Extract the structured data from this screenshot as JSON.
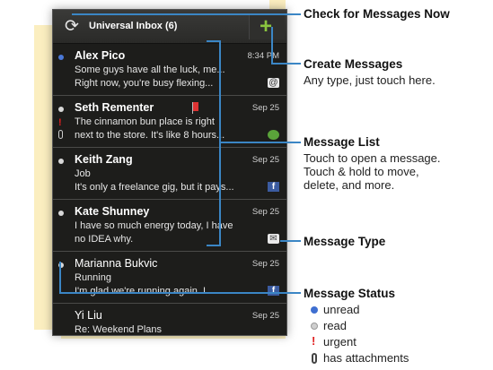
{
  "header": {
    "title": "Universal Inbox (6)",
    "refresh_icon": "refresh-icon",
    "add_icon": "plus-icon",
    "add_glyph": "+"
  },
  "messages": [
    {
      "sender": "Alex Pico",
      "date": "8:34 PM",
      "line1": "Some guys have all the luck, me...",
      "line2": "Right now, you're busy flexing...",
      "status": "unread",
      "type": "email"
    },
    {
      "sender": "Seth Rementer",
      "date": "Sep 25",
      "line1": "The cinnamon bun place is right",
      "line2": "next to the store. It's like 8 hours...",
      "status": "read",
      "type": "sms"
    },
    {
      "sender": "Keith Zang",
      "date": "Sep 25",
      "line1": "Job",
      "line2": "It's only a freelance gig, but it pays...",
      "status": "read",
      "type": "facebook"
    },
    {
      "sender": "Kate Shunney",
      "date": "Sep 25",
      "line1": "I have so much energy today, I have",
      "line2": "no IDEA why.",
      "status": "read",
      "type": "text"
    },
    {
      "sender": "Marianna Bukvic",
      "date": "Sep 25",
      "line1": "Running",
      "line2": "I'm glad we're running again. I...",
      "status": "read",
      "type": "facebook"
    },
    {
      "sender": "Yi Liu",
      "date": "Sep 25",
      "line1": "Re: Weekend Plans",
      "line2": "",
      "status": "read",
      "type": ""
    }
  ],
  "urgent_glyph": "!",
  "annotations": {
    "check": {
      "title": "Check for Messages Now"
    },
    "create": {
      "title": "Create Messages",
      "body": "Any type, just touch here."
    },
    "list": {
      "title": "Message List",
      "body1": "Touch to open a message.",
      "body2": "Touch & hold to move,",
      "body3": "delete, and more."
    },
    "type": {
      "title": "Message Type"
    },
    "status": {
      "title": "Message Status"
    }
  },
  "legend": [
    {
      "label": "unread",
      "icon": "unread-dot-icon"
    },
    {
      "label": "read",
      "icon": "read-dot-icon"
    },
    {
      "label": "urgent",
      "icon": "urgent-icon"
    },
    {
      "label": "has attachments",
      "icon": "attachment-icon"
    }
  ],
  "colors": {
    "callout": "#3b86c5",
    "accent_green": "#8ac43f",
    "unread_blue": "#3f6fd1",
    "urgent_red": "#e02020"
  }
}
